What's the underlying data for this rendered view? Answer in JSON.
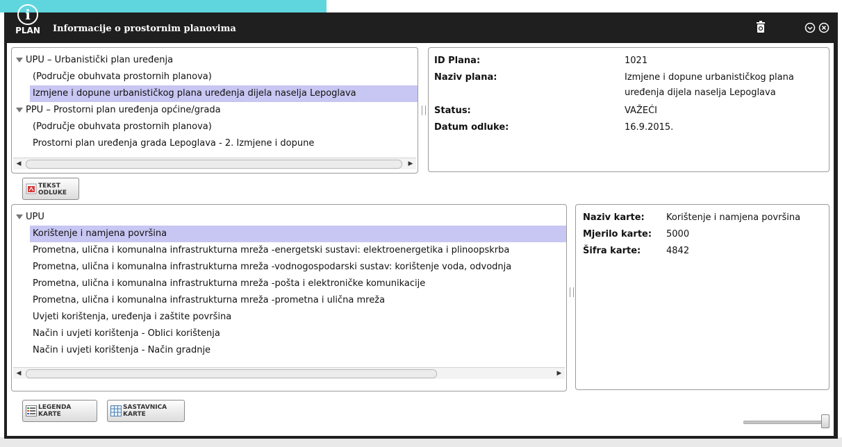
{
  "window": {
    "logo_text": "PLAN",
    "title": "Informacije o prostornim planovima"
  },
  "plans_tree": {
    "groups": [
      {
        "label": "UPU – Urbanistički plan uređenja",
        "sublabel": "(Područje obuhvata prostornih planova)",
        "items": [
          "Izmjene i dopune urbanističkog plana uređenja dijela naselja Lepoglava"
        ]
      },
      {
        "label": "PPU – Prostorni plan uređenja općine/grada",
        "sublabel": "(Područje obuhvata prostornih planova)",
        "items": [
          "Prostorni plan uređenja grada Lepoglava - 2. Izmjene i dopune"
        ]
      }
    ]
  },
  "plan_info": {
    "id_label": "ID Plana:",
    "id_value": "1021",
    "name_label": "Naziv plana:",
    "name_value_line1": "Izmjene i dopune urbanističkog plana",
    "name_value_line2": "uređenja dijela naselja Lepoglava",
    "status_label": "Status:",
    "status_value": "VAŽEĆI",
    "date_label": "Datum odluke:",
    "date_value": "16.9.2015."
  },
  "buttons": {
    "tekst_line1": "TEKST",
    "tekst_line2": "ODLUKE",
    "legenda_line1": "LEGENDA",
    "legenda_line2": "KARTE",
    "sastavnica_line1": "SASTAVNICA",
    "sastavnica_line2": "KARTE"
  },
  "maps_tree": {
    "root": "UPU",
    "items": [
      "Korištenje i namjena površina",
      "Prometna, ulična i komunalna infrastrukturna mreža -energetski sustavi: elektroenergetika i plinoopskrba",
      "Prometna, ulična i komunalna infrastrukturna mreža -vodnogospodarski sustav: korištenje voda, odvodnja",
      "Prometna, ulična i komunalna infrastrukturna mreža -pošta i elektroničke komunikacije",
      "Prometna, ulična i komunalna infrastrukturna mreža -prometna i ulična mreža",
      "Uvjeti korištenja, uređenja i zaštite površina",
      "Način i uvjeti korištenja - Oblici korištenja",
      "Način i uvjeti korištenja - Način gradnje"
    ]
  },
  "map_info": {
    "name_label": "Naziv karte:",
    "name_value": "Korištenje i namjena površina",
    "scale_label": "Mjerilo karte:",
    "scale_value": "5000",
    "code_label": "Šifra karte:",
    "code_value": "4842"
  },
  "colors": {
    "titlebar": "#1f1f1f",
    "selection": "#c8c6f2"
  }
}
